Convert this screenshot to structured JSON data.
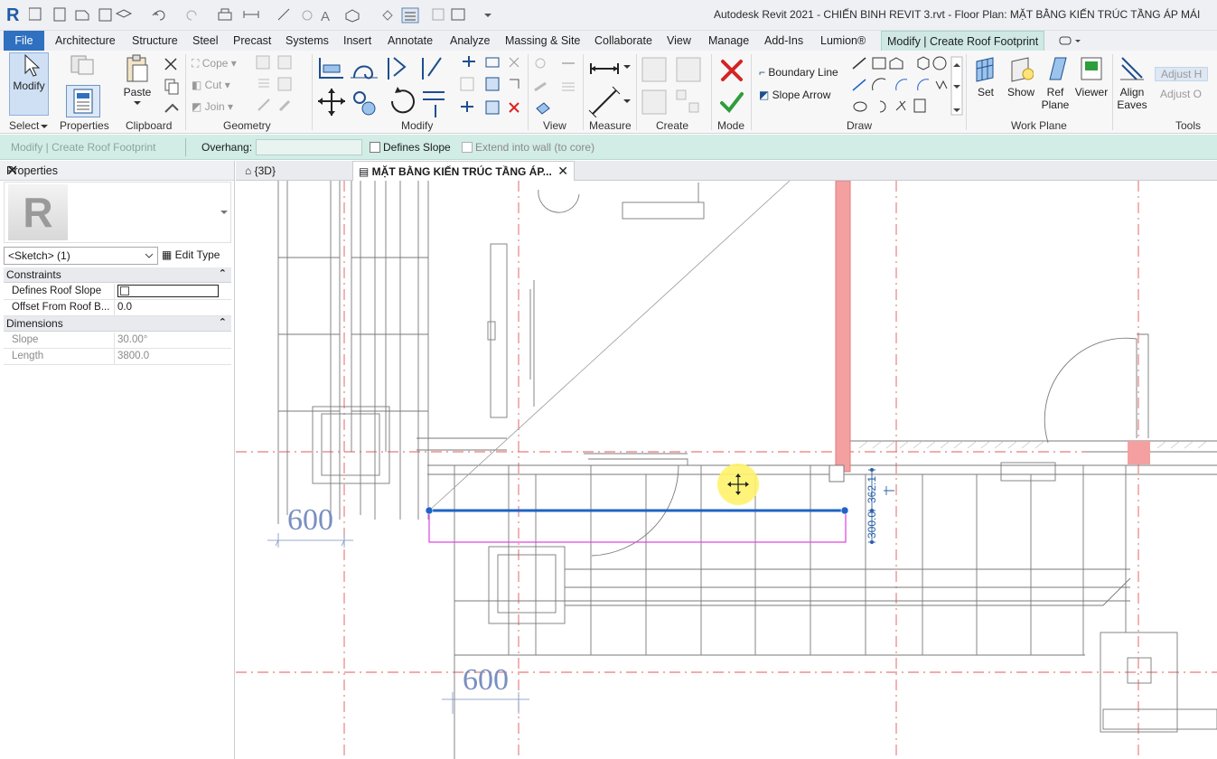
{
  "app": {
    "title": "Autodesk Revit 2021 - CHIẾN BINH REVIT 3.rvt - Floor Plan: MẶT BẰNG KIẾN TRÚC TẦNG ÁP MÁI",
    "logo": "R"
  },
  "tabs": [
    {
      "label": "File"
    },
    {
      "label": "Architecture"
    },
    {
      "label": "Structure"
    },
    {
      "label": "Steel"
    },
    {
      "label": "Precast"
    },
    {
      "label": "Systems"
    },
    {
      "label": "Insert"
    },
    {
      "label": "Annotate"
    },
    {
      "label": "Analyze"
    },
    {
      "label": "Massing & Site"
    },
    {
      "label": "Collaborate"
    },
    {
      "label": "View"
    },
    {
      "label": "Manage"
    },
    {
      "label": "Add-Ins"
    },
    {
      "label": "Lumion®"
    },
    {
      "label": "Modify | Create Roof Footprint"
    }
  ],
  "ribbon": {
    "select": {
      "modify": "Modify",
      "panel": "Select"
    },
    "properties": {
      "label": "Properties",
      "panel": "Properties"
    },
    "clipboard": {
      "paste": "Paste",
      "panel": "Clipboard"
    },
    "geometry": {
      "cope": "Cope",
      "cut": "Cut",
      "join": "Join",
      "panel": "Geometry"
    },
    "modify_panel": "Modify",
    "view_panel": "View",
    "measure_panel": "Measure",
    "create_panel": "Create",
    "mode_panel": "Mode",
    "draw": {
      "boundary": "Boundary Line",
      "slope": "Slope Arrow",
      "panel": "Draw"
    },
    "workplane": {
      "set": "Set",
      "show": "Show",
      "ref": "Ref",
      "plane": "Plane",
      "viewer": "Viewer",
      "panel": "Work Plane"
    },
    "tools": {
      "align": "Align",
      "eaves": "Eaves",
      "adjust1": "Adjust H",
      "adjust2": "Adjust O",
      "panel": "Tools"
    }
  },
  "options": {
    "context": "Modify | Create Roof Footprint",
    "overhang_label": "Overhang:",
    "overhang_value": "",
    "defines_slope": "Defines Slope",
    "extend": "Extend into wall (to core)"
  },
  "properties": {
    "title": "Properties",
    "selector": "<Sketch> (1)",
    "edit_type": "Edit Type",
    "constraints": "Constraints",
    "dimensions": "Dimensions",
    "rows": [
      {
        "key": "Defines Roof Slope",
        "value": ""
      },
      {
        "key": "Offset From Roof B...",
        "value": "0.0"
      },
      {
        "key": "Slope",
        "value": "30.00°"
      },
      {
        "key": "Length",
        "value": "3800.0"
      }
    ]
  },
  "view_tabs": [
    {
      "label": "{3D}"
    },
    {
      "label": "MẶT BẰNG KIẾN TRÚC TẦNG ÁP..."
    }
  ],
  "drawing": {
    "dim_600_a": "600",
    "dim_600_b": "600",
    "dim_362": "362.1",
    "dim_300": "300.0"
  },
  "colors": {
    "accent": "#2f70c0",
    "context_tab": "#cfe8e3",
    "sketch_line": "#1e63c8",
    "wall_red": "#f4a0a0",
    "magenta": "#e040e0"
  }
}
